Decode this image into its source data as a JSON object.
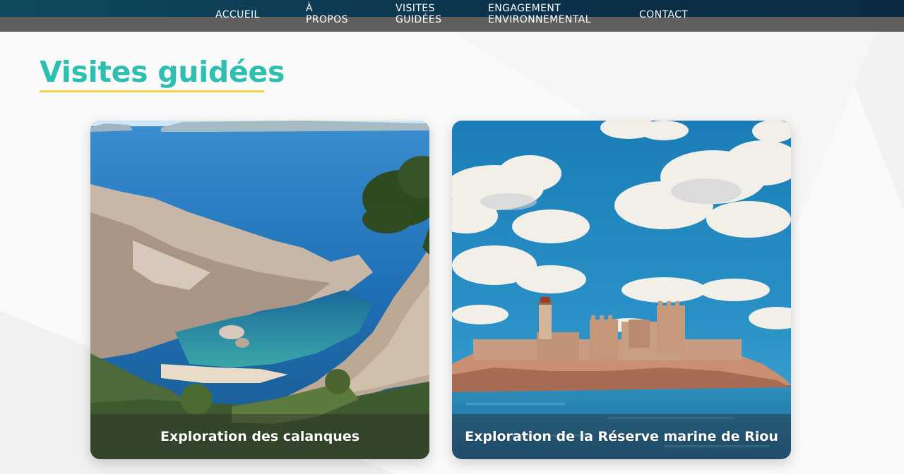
{
  "nav": {
    "items": [
      {
        "lines": [
          "ACCUEIL"
        ]
      },
      {
        "lines": [
          "À",
          "PROPOS"
        ]
      },
      {
        "lines": [
          "VISITES",
          "GUIDÉES"
        ]
      },
      {
        "lines": [
          "ENGAGEMENT",
          "ENVIRONNEMENTAL"
        ]
      },
      {
        "lines": [
          "CONTACT"
        ]
      }
    ]
  },
  "page": {
    "title": "Visites guidées"
  },
  "tours": [
    {
      "caption": "Exploration des calanques",
      "image": "calanque-cove-photo"
    },
    {
      "caption": "Exploration de la Réserve marine de Riou",
      "image": "chateau-if-island-photo"
    }
  ],
  "colors": {
    "accent": "#2dbfb0",
    "underline": "#f2d049",
    "nav_top": "#0d3a52",
    "nav_bar": "#5f5f5f"
  }
}
